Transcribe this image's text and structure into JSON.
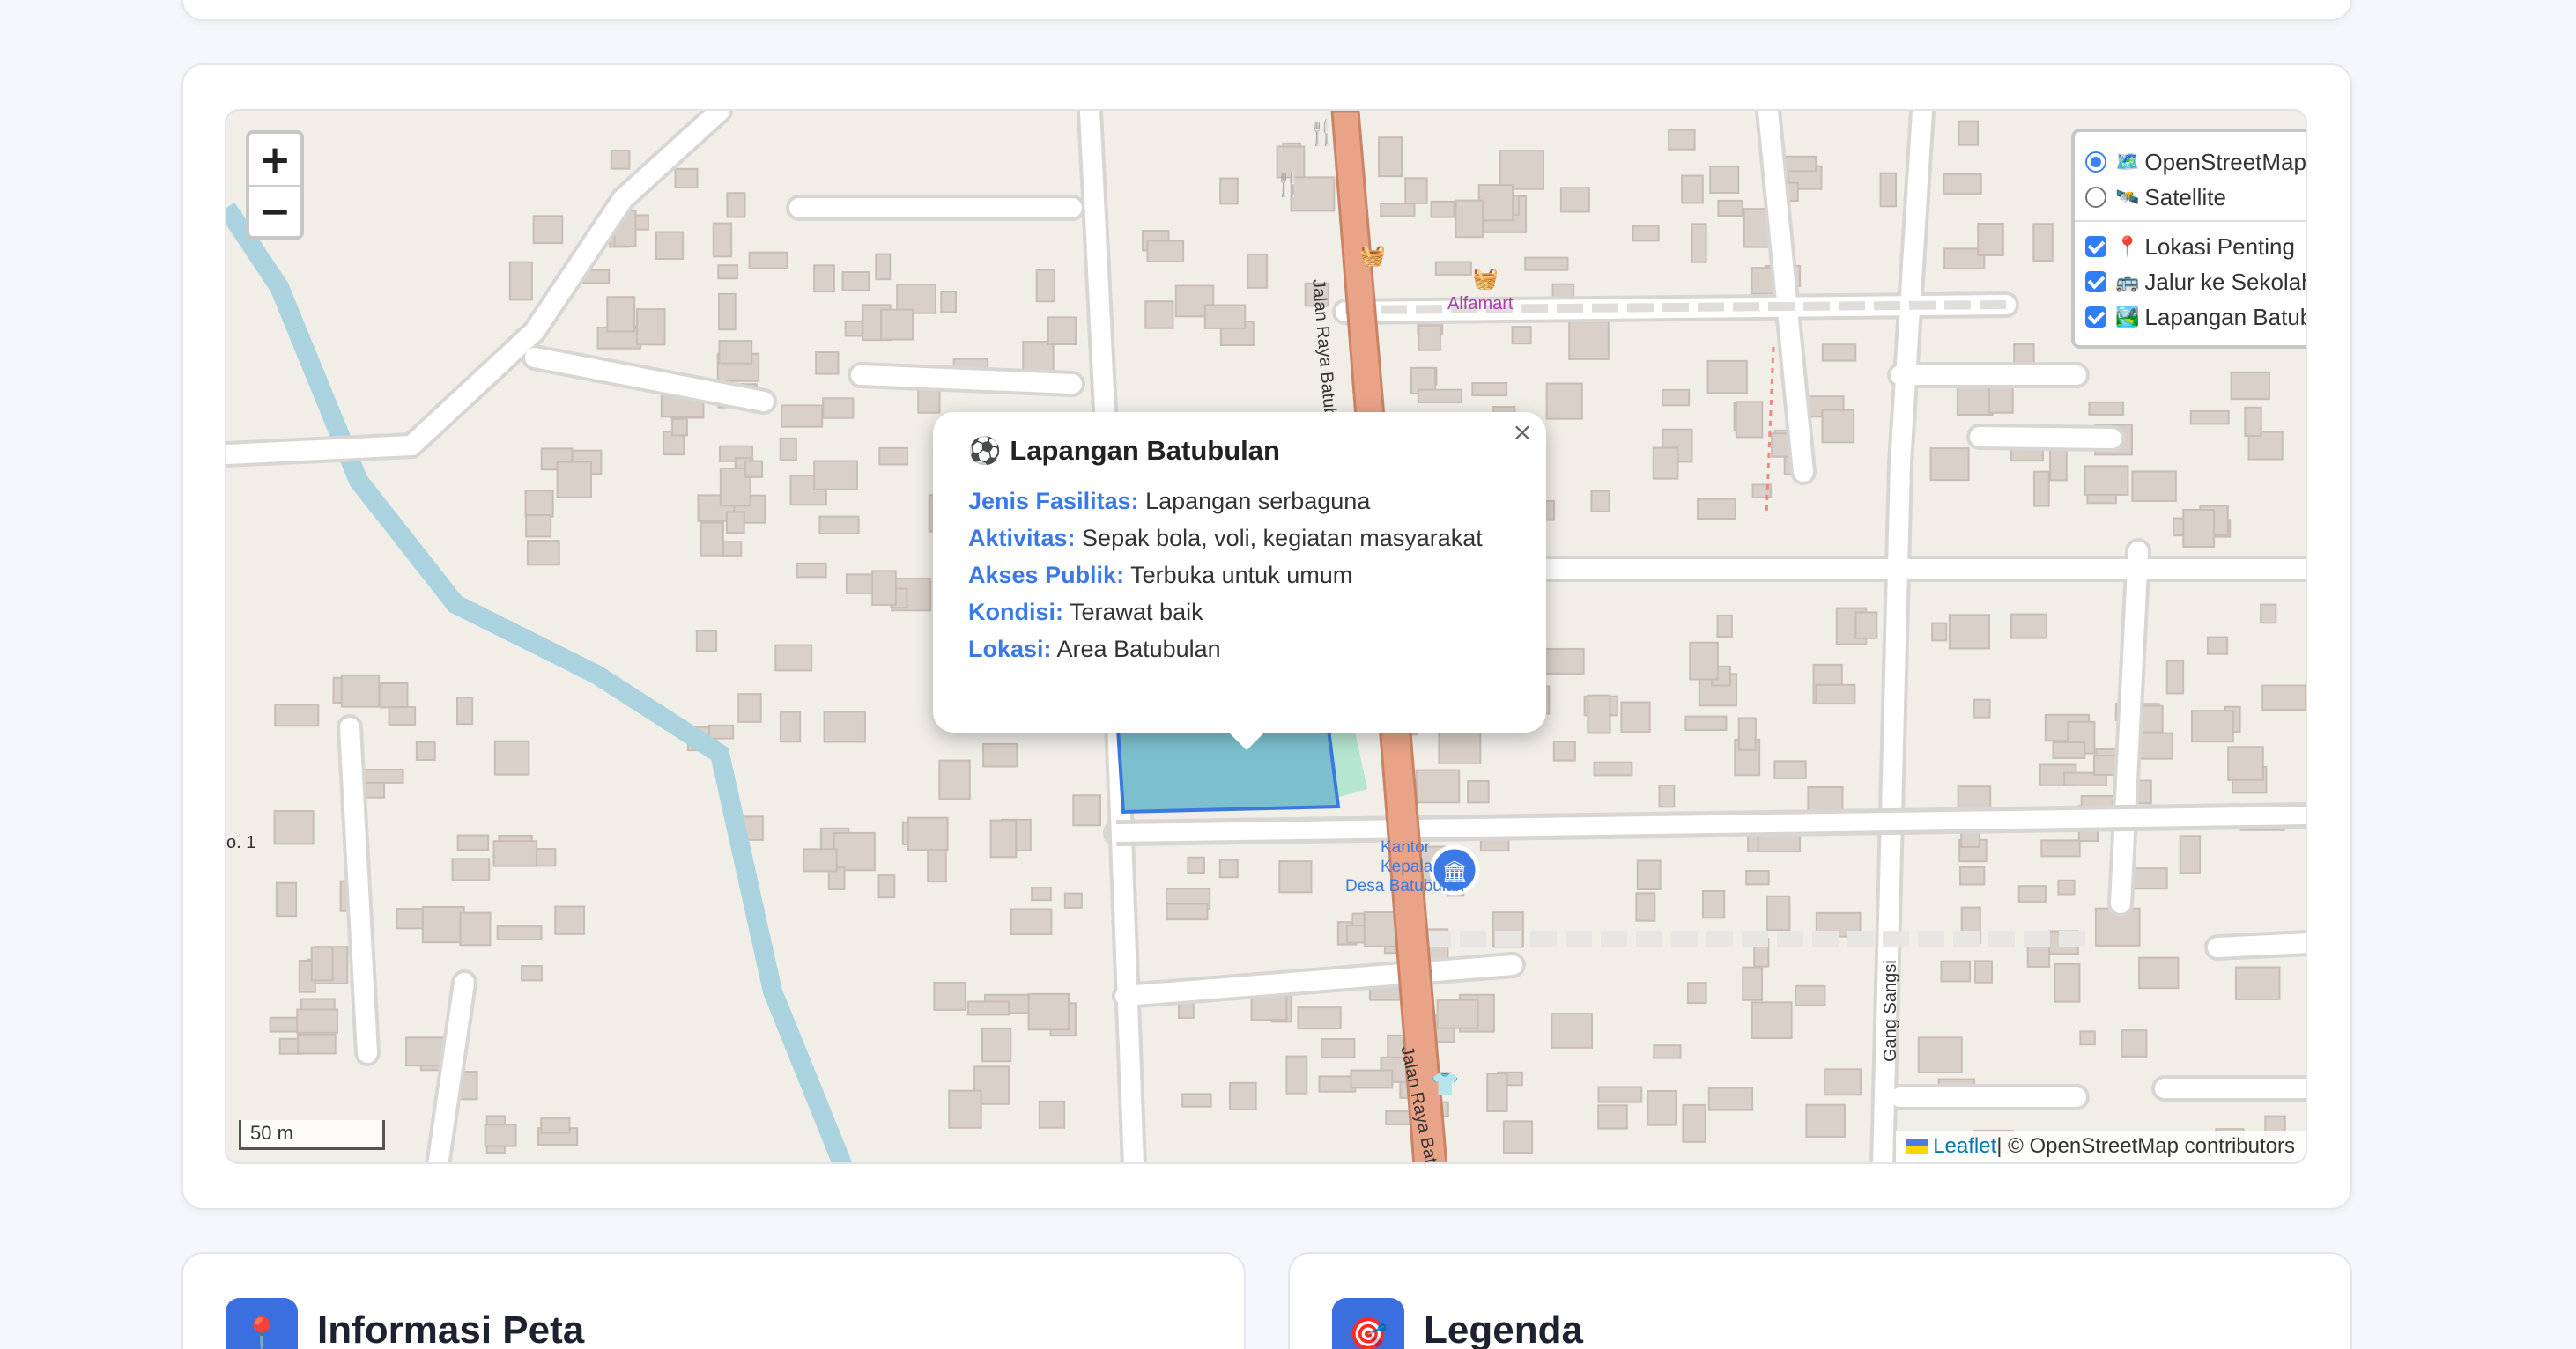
{
  "map": {
    "zoom_in": "+",
    "zoom_out": "−",
    "scale_label": "50 m",
    "attribution": {
      "leaflet": "Leaflet",
      "rest": " | © OpenStreetMap contributors"
    },
    "labels": {
      "road_north": "Jalan Raya Batubulan",
      "road_south": "Jalan Raya Batubulan",
      "road_east": "Gang Sangsi",
      "alfamart": "Alfamart",
      "office_1": "Kantor",
      "office_2": "Kepala",
      "office_3": "Desa Batubulan",
      "edge_label": "o. 1"
    }
  },
  "layers": {
    "base": [
      {
        "label": "OpenStreetMap",
        "icon": "🗺️",
        "selected": true
      },
      {
        "label": "Satellite",
        "icon": "🛰️",
        "selected": false
      }
    ],
    "overlays": [
      {
        "label": "Lokasi Penting",
        "icon": "📍",
        "checked": true
      },
      {
        "label": "Jalur ke Sekolah",
        "icon": "🚌",
        "checked": true
      },
      {
        "label": "Lapangan Batubulan",
        "icon": "🏞️",
        "checked": true
      }
    ]
  },
  "popup": {
    "title": "Lapangan Batubulan",
    "icon": "⚽",
    "close": "×",
    "rows": [
      {
        "key": "Jenis Fasilitas:",
        "value": " Lapangan serbaguna"
      },
      {
        "key": "Aktivitas:",
        "value": " Sepak bola, voli, kegiatan masyarakat"
      },
      {
        "key": "Akses Publik:",
        "value": " Terbuka untuk umum"
      },
      {
        "key": "Kondisi:",
        "value": " Terawat baik"
      },
      {
        "key": "Lokasi:",
        "value": " Area Batubulan"
      }
    ]
  },
  "cards": {
    "info": {
      "title": "Informasi Peta",
      "icon": "📍"
    },
    "legend": {
      "title": "Legenda",
      "icon": "🎯"
    }
  },
  "colors": {
    "accent": "#3b79e6",
    "primary_road": "#e9a386",
    "river": "#aad3df",
    "building": "#d9d0c9",
    "field_polygon": "#7cc0cf"
  }
}
